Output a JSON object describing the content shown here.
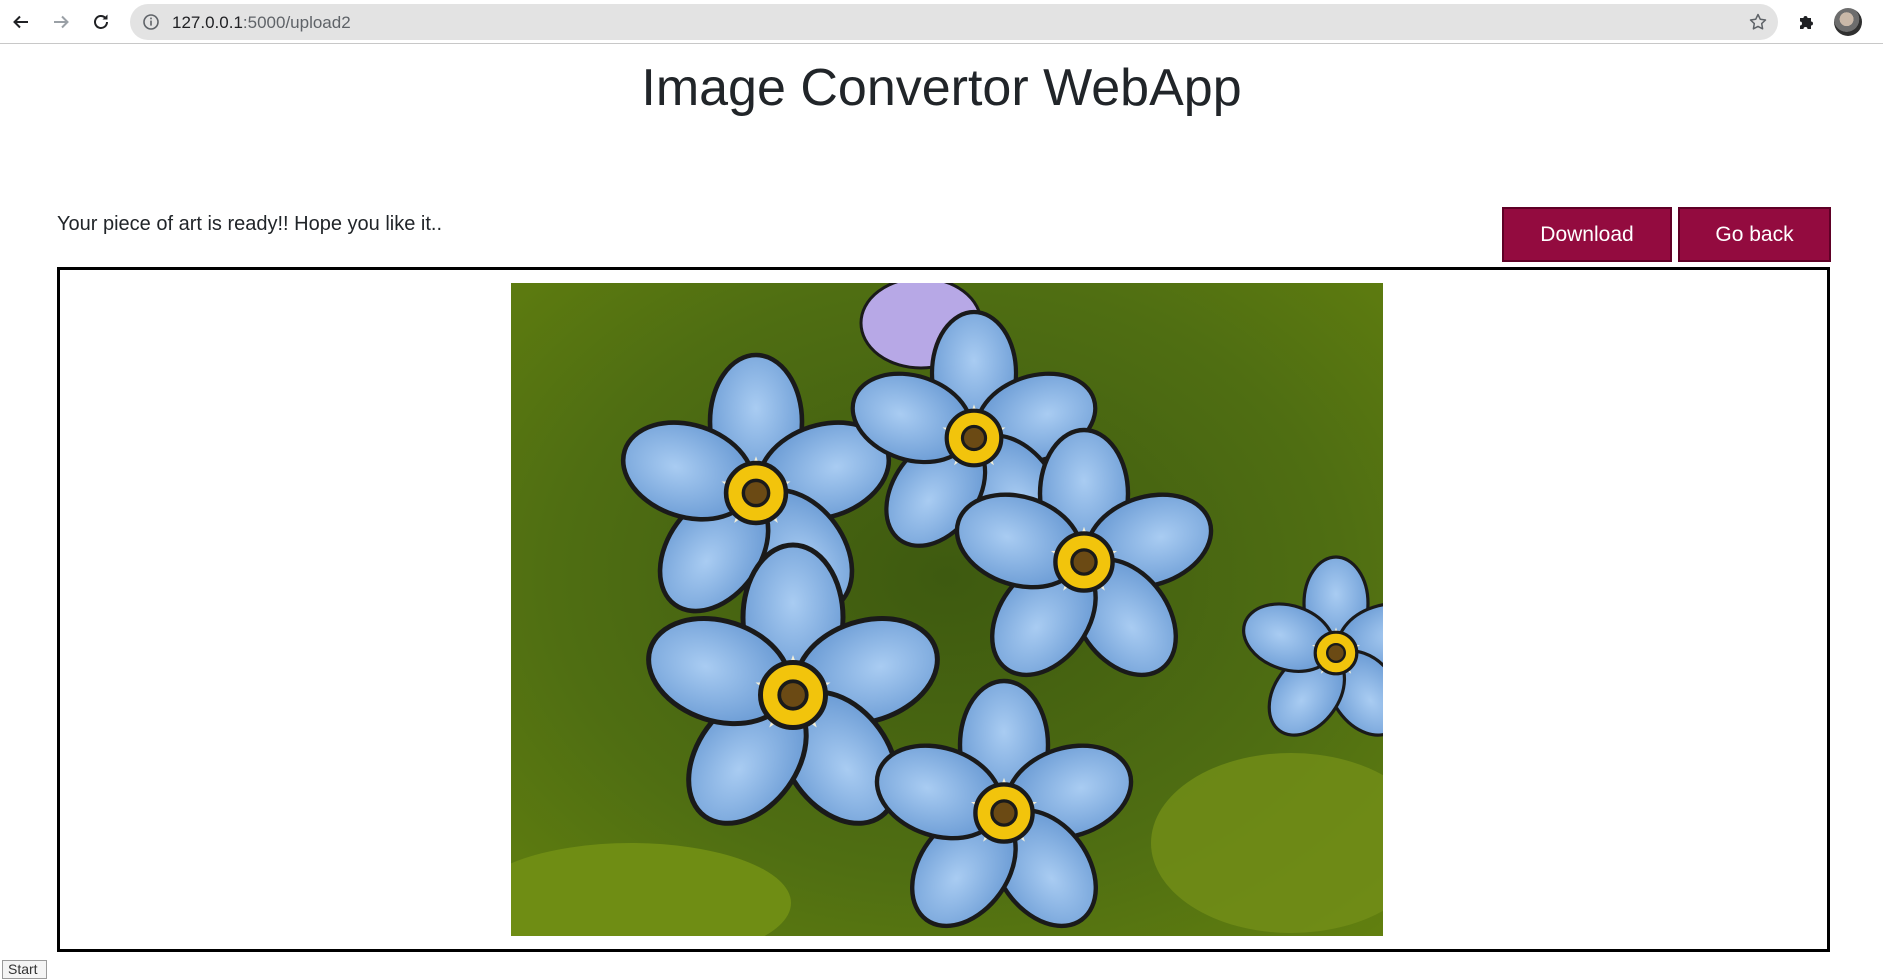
{
  "browser": {
    "url_host": "127.0.0.1",
    "url_path": ":5000/upload2",
    "icons": [
      "back-arrow-icon",
      "forward-arrow-icon",
      "reload-icon",
      "info-icon",
      "star-icon",
      "puzzle-icon",
      "avatar"
    ]
  },
  "page": {
    "title": "Image Convertor WebApp",
    "message": "Your piece of art is ready!! Hope you like it..",
    "download_label": "Download",
    "back_label": "Go back",
    "image_alt": "cartoonized forget-me-not flowers"
  },
  "taskbar": {
    "start_label": "Start"
  },
  "colors": {
    "button_bg": "#930b3f",
    "button_border": "#5f0026",
    "frame_border": "#000000"
  }
}
